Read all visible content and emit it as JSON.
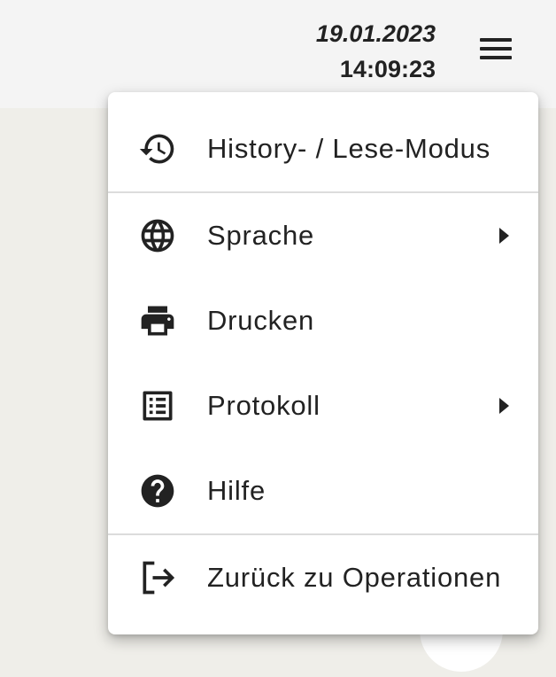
{
  "header": {
    "date": "19.01.2023",
    "time": "14:09:23"
  },
  "menu": {
    "items": [
      {
        "label": "History- / Lese-Modus",
        "icon": "history-icon",
        "submenu": false
      },
      {
        "label": "Sprache",
        "icon": "globe-icon",
        "submenu": true
      },
      {
        "label": "Drucken",
        "icon": "print-icon",
        "submenu": false
      },
      {
        "label": "Protokoll",
        "icon": "list-document-icon",
        "submenu": true
      },
      {
        "label": "Hilfe",
        "icon": "help-icon",
        "submenu": false
      },
      {
        "label": "Zurück zu Operationen",
        "icon": "logout-icon",
        "submenu": false
      }
    ]
  },
  "colors": {
    "background": "#efeee9",
    "topbar": "#f4f4f4",
    "menu": "#ffffff",
    "text": "#222222",
    "divider": "#dcdcdc"
  }
}
